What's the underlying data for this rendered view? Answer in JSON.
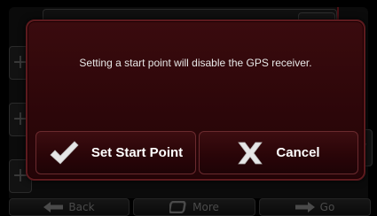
{
  "dialog": {
    "message": "Setting a start point will disable the GPS receiver.",
    "confirm_label": "Set Start Point",
    "cancel_label": "Cancel"
  },
  "bottom_bar": {
    "back_label": "Back",
    "more_label": "More",
    "go_label": "Go"
  },
  "colors": {
    "dialog_bg": "#2c0609",
    "dialog_border": "#5d1a1e",
    "text": "#ffffff"
  }
}
